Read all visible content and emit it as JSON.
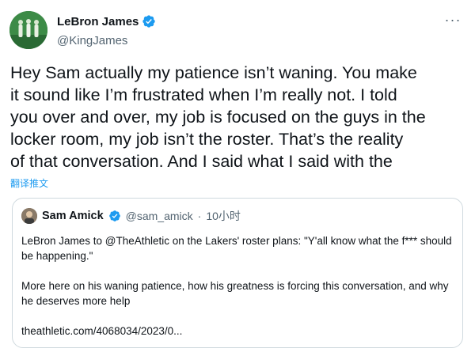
{
  "author": {
    "display_name": "LeBron James",
    "handle": "@KingJames",
    "more_icon": "ellipsis-icon"
  },
  "tweet": {
    "text": "Hey Sam actually my patience isn’t waning. You make\nit sound like I’m frustrated when I’m really not. I told\nyou over and over, my job is focused on the guys in the\nlocker room, my job isn’t the roster. That’s the reality\nof that conversation. And I said what I said with the",
    "translate_label": "翻译推文"
  },
  "quote": {
    "display_name": "Sam Amick",
    "handle": "@sam_amick",
    "separator": "·",
    "time": "10小时",
    "paragraph1": "LeBron James to @TheAthletic on the Lakers' roster plans: \"Y'all know what the f*** should be happening.\"",
    "paragraph2": "More here on his waning patience, how his greatness is forcing this conversation, and why he deserves more help",
    "link": "theathletic.com/4068034/2023/0..."
  },
  "colors": {
    "accent": "#1d9bf0",
    "text": "#0f1419",
    "secondary": "#536471",
    "border": "#cfd9de"
  }
}
